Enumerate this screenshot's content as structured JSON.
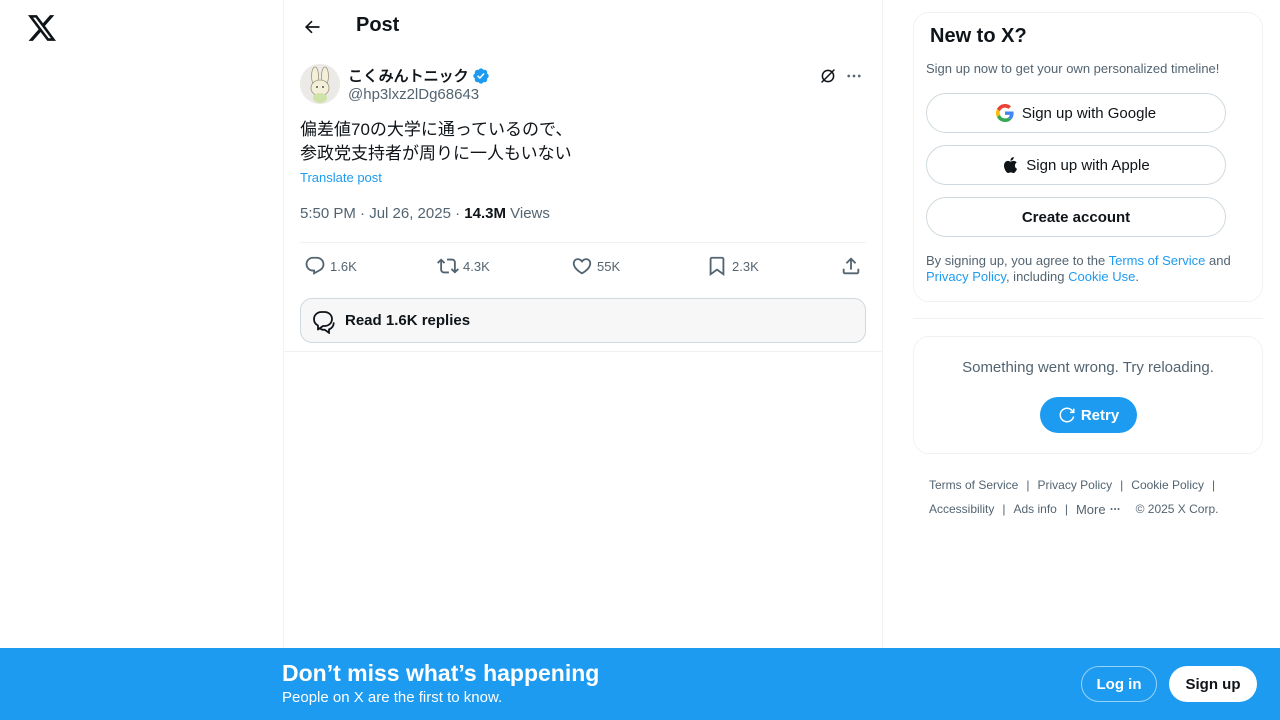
{
  "nav": {
    "logo_icon": "x-logo-icon"
  },
  "header": {
    "back_icon": "arrow-left-icon",
    "title": "Post"
  },
  "post": {
    "author_name": "こくみんトニック",
    "verified_icon": "verified-badge-icon",
    "author_handle": "@hp3lxz2lDg68643",
    "text": "偏差値70の大学に通っているので、\n参政党支持者が周りに一人もいない",
    "translate_label": "Translate post",
    "time": "5:50 PM · Jul 26, 2025 · ",
    "views_count": "14.3M",
    "views_label": " Views"
  },
  "actions": {
    "replies": "1.6K",
    "reposts": "4.3K",
    "likes": "55K",
    "bookmarks": "2.3K"
  },
  "read_replies_label": "Read 1.6K replies",
  "signup_card": {
    "title": "New to X?",
    "subtitle": "Sign up now to get your own personalized timeline!",
    "google_label": "Sign up with Google",
    "apple_label": "Sign up with Apple",
    "create_label": "Create account",
    "terms_prefix": "By signing up, you agree to the ",
    "terms_link": "Terms of Service",
    "terms_and": " and ",
    "privacy_link": "Privacy Policy",
    "terms_including": ", including ",
    "cookie_link": "Cookie Use",
    "terms_end": "."
  },
  "error_card": {
    "message": "Something went wrong. Try reloading.",
    "retry_label": "Retry"
  },
  "footer": {
    "terms": "Terms of Service",
    "privacy": "Privacy Policy",
    "cookie": "Cookie Policy",
    "accessibility": "Accessibility",
    "ads": "Ads info",
    "more": "More",
    "copyright": "© 2025 X Corp."
  },
  "bottom_bar": {
    "title": "Don’t miss what’s happening",
    "subtitle": "People on X are the first to know.",
    "login_label": "Log in",
    "signup_label": "Sign up"
  },
  "colors": {
    "accent": "#1d9bf0",
    "text": "#0f1419",
    "secondary": "#536471"
  }
}
